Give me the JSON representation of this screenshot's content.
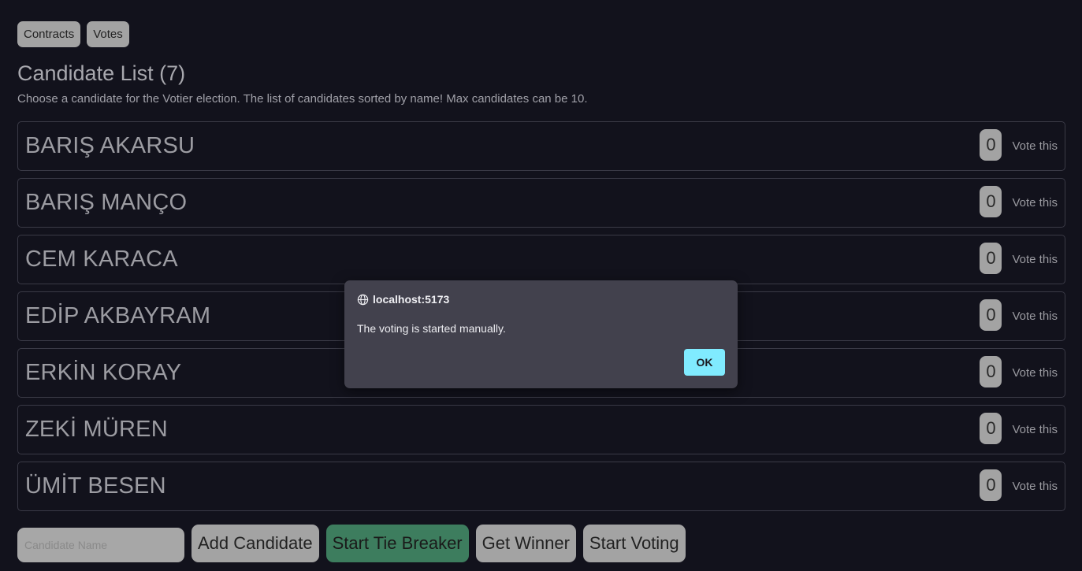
{
  "tabs": [
    "Contracts",
    "Votes"
  ],
  "title": "Candidate List (7)",
  "subtitle": "Choose a candidate for the Votier election. The list of candidates sorted by name! Max candidates can be 10.",
  "candidates": [
    {
      "name": "BARIŞ AKARSU",
      "votes": "0",
      "action": "Vote this"
    },
    {
      "name": "BARIŞ MANÇO",
      "votes": "0",
      "action": "Vote this"
    },
    {
      "name": "CEM KARACA",
      "votes": "0",
      "action": "Vote this"
    },
    {
      "name": "EDİP AKBAYRAM",
      "votes": "0",
      "action": "Vote this"
    },
    {
      "name": "ERKİN KORAY",
      "votes": "0",
      "action": "Vote this"
    },
    {
      "name": "ZEKİ MÜREN",
      "votes": "0",
      "action": "Vote this"
    },
    {
      "name": "ÜMİT BESEN",
      "votes": "0",
      "action": "Vote this"
    }
  ],
  "footer": {
    "input_placeholder": "Candidate Name",
    "add_label": "Add Candidate",
    "tie_label": "Start Tie Breaker",
    "winner_label": "Get Winner",
    "start_label": "Start Voting"
  },
  "dialog": {
    "origin": "localhost:5173",
    "message": "The voting is started manually.",
    "ok_label": "OK",
    "icon": "globe-icon"
  },
  "colors": {
    "background": "#12121c",
    "tie_breaker": "#3d7d5e",
    "ok_button": "#80ebff",
    "dialog_bg": "#42414d"
  }
}
